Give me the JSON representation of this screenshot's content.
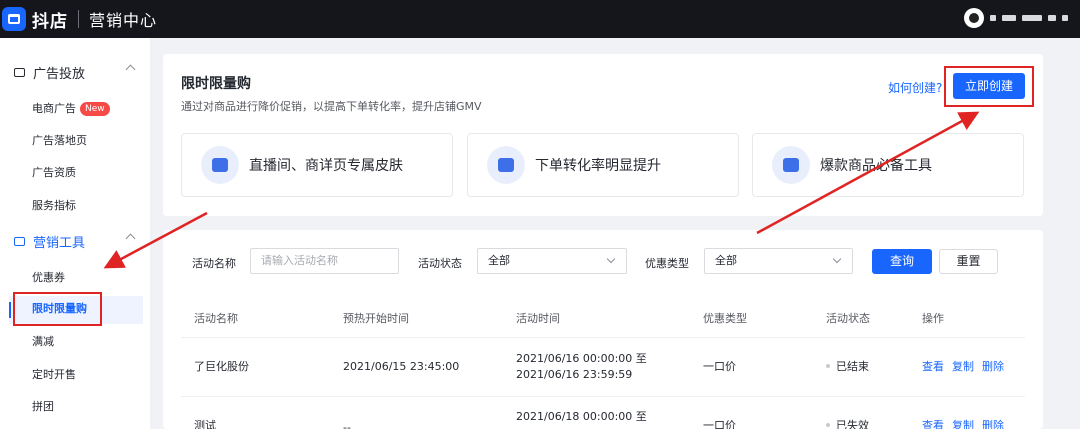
{
  "app": {
    "logo_text": "抖店",
    "section": "营销中心"
  },
  "sidebar": {
    "groups": [
      {
        "label": "广告投放"
      },
      {
        "label": "营销工具"
      }
    ],
    "items": [
      {
        "label": "电商广告",
        "badge": "New"
      },
      {
        "label": "广告落地页"
      },
      {
        "label": "广告资质"
      },
      {
        "label": "服务指标"
      },
      {
        "label": "优惠券"
      },
      {
        "label": "限时限量购"
      },
      {
        "label": "满减"
      },
      {
        "label": "定时开售"
      },
      {
        "label": "拼团"
      }
    ]
  },
  "page": {
    "title": "限时限量购",
    "subtitle": "通过对商品进行降价促销，以提高下单转化率，提升店铺GMV",
    "how_link": "如何创建?",
    "create_label": "立即创建",
    "features": [
      {
        "label": "直播间、商详页专属皮肤",
        "icon": "cart-icon"
      },
      {
        "label": "下单转化率明显提升",
        "icon": "trend-chart-icon"
      },
      {
        "label": "爆款商品必备工具",
        "icon": "shopping-bag-icon"
      }
    ]
  },
  "filters": {
    "name_label": "活动名称",
    "name_placeholder": "请输入活动名称",
    "status_label": "活动状态",
    "status_value": "全部",
    "type_label": "优惠类型",
    "type_value": "全部",
    "query_label": "查询",
    "reset_label": "重置"
  },
  "table": {
    "columns": [
      "活动名称",
      "预热开始时间",
      "活动时间",
      "优惠类型",
      "活动状态",
      "操作"
    ],
    "rows": [
      {
        "name": "了巨化股份",
        "preheat": "2021/06/15 23:45:00",
        "time_start": "2021/06/16 00:00:00 至",
        "time_end": "2021/06/16 23:59:59",
        "type": "一口价",
        "status": "已结束",
        "actions": [
          "查看",
          "复制",
          "删除"
        ]
      },
      {
        "name": "测试",
        "preheat": "--",
        "time_start": "2021/06/18 00:00:00 至",
        "time_end": "",
        "type": "一口价",
        "status": "已失效",
        "actions": [
          "查看",
          "复制",
          "删除"
        ]
      }
    ]
  },
  "colors": {
    "brand": "#1966ff",
    "annotation": "#e02424",
    "topbar": "#14161c"
  }
}
